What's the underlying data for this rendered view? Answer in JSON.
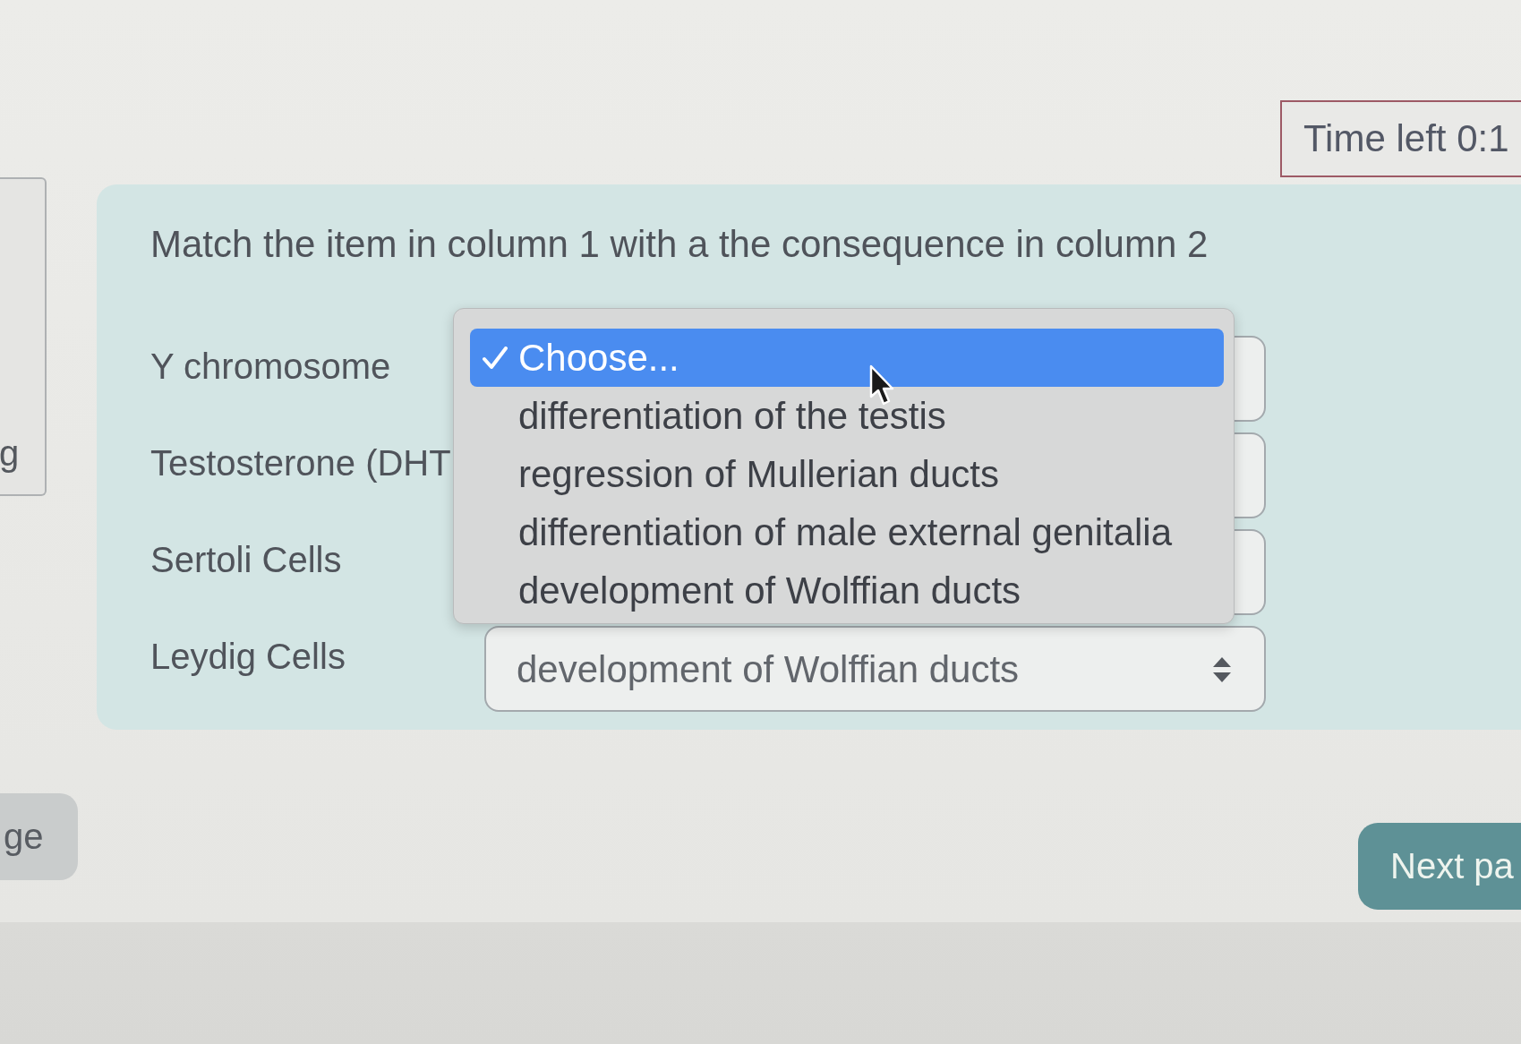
{
  "timer": {
    "text": "Time left 0:1"
  },
  "side_panel": {
    "text": "g"
  },
  "question": {
    "prompt": "Match the item in column 1 with a the consequence in column 2",
    "rows": [
      {
        "label": "Y chromosome",
        "open": true
      },
      {
        "label": "Testosterone (DHT",
        "open": false
      },
      {
        "label": "Sertoli Cells",
        "open": false
      },
      {
        "label": "Leydig Cells",
        "open": false,
        "value": "development of Wolffian ducts"
      }
    ]
  },
  "dropdown_menu": {
    "options": [
      {
        "label": "Choose...",
        "selected": true
      },
      {
        "label": "differentiation of the testis",
        "selected": false
      },
      {
        "label": "regression of Mullerian ducts",
        "selected": false
      },
      {
        "label": "differentiation of male external genitalia",
        "selected": false
      },
      {
        "label": "development of Wolffian ducts",
        "selected": false
      }
    ]
  },
  "buttons": [
    {
      "kind": "previous",
      "label": "ge"
    },
    {
      "kind": "next",
      "label": "Next pa"
    }
  ]
}
